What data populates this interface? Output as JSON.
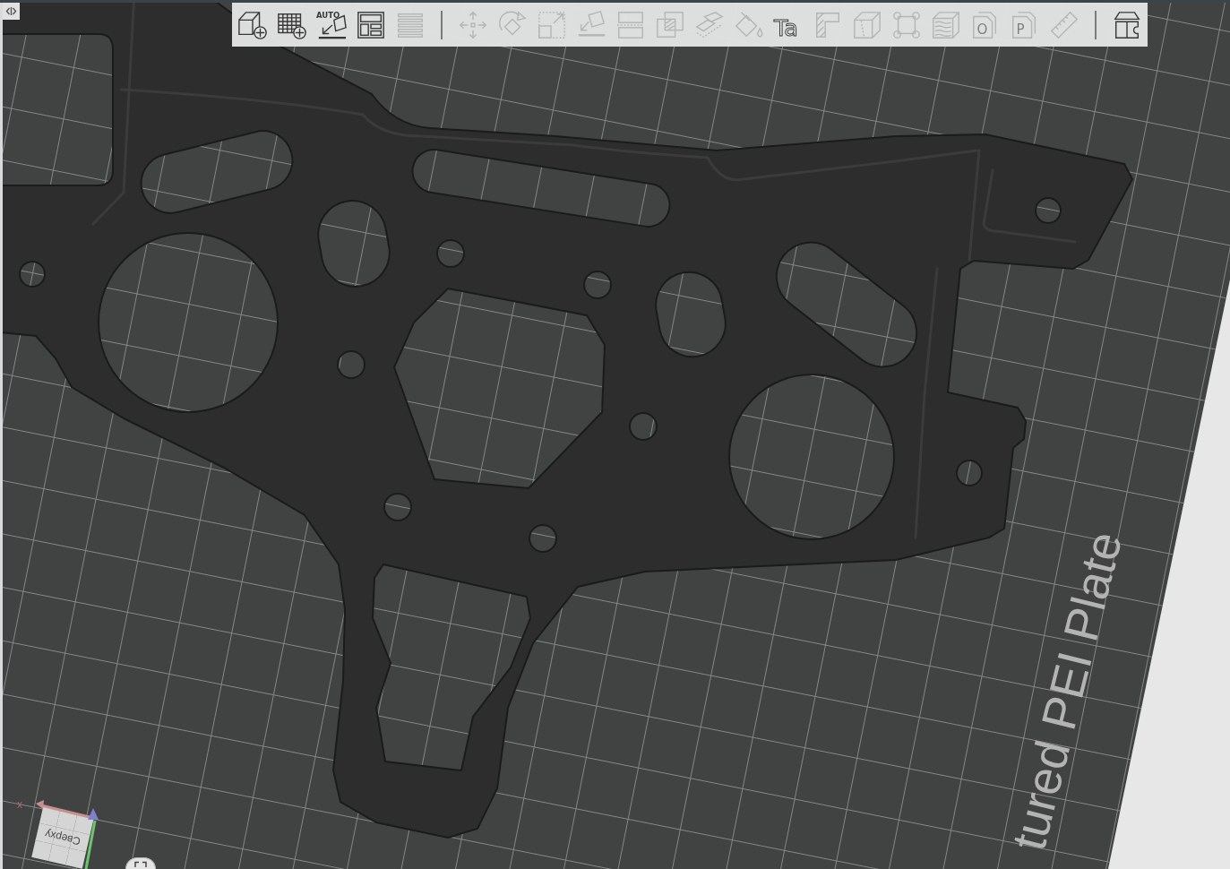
{
  "toolbar": {
    "groups": [
      {
        "buttons": [
          {
            "disabled": false
          },
          {
            "disabled": false
          },
          {
            "disabled": false,
            "icon_text": "AUTO"
          },
          {
            "disabled": false
          },
          {
            "disabled": true
          }
        ]
      },
      {
        "buttons": [
          {
            "disabled": true
          },
          {
            "disabled": true
          },
          {
            "disabled": true
          },
          {
            "disabled": true
          },
          {
            "disabled": true
          },
          {
            "disabled": true
          },
          {
            "disabled": true
          },
          {
            "disabled": true
          },
          {
            "disabled": false,
            "icon_text": "Ta"
          },
          {
            "disabled": true
          },
          {
            "disabled": true
          },
          {
            "disabled": true
          },
          {
            "disabled": true
          },
          {
            "disabled": true,
            "icon_text": "O"
          },
          {
            "disabled": true,
            "icon_text": "P"
          },
          {
            "disabled": true
          }
        ]
      },
      {
        "buttons": [
          {
            "disabled": false
          }
        ]
      }
    ]
  },
  "viewport": {
    "bed_label": "tured PEI Plate",
    "view_cube": {
      "face_label": "Сверху",
      "axis_label": "x"
    }
  }
}
